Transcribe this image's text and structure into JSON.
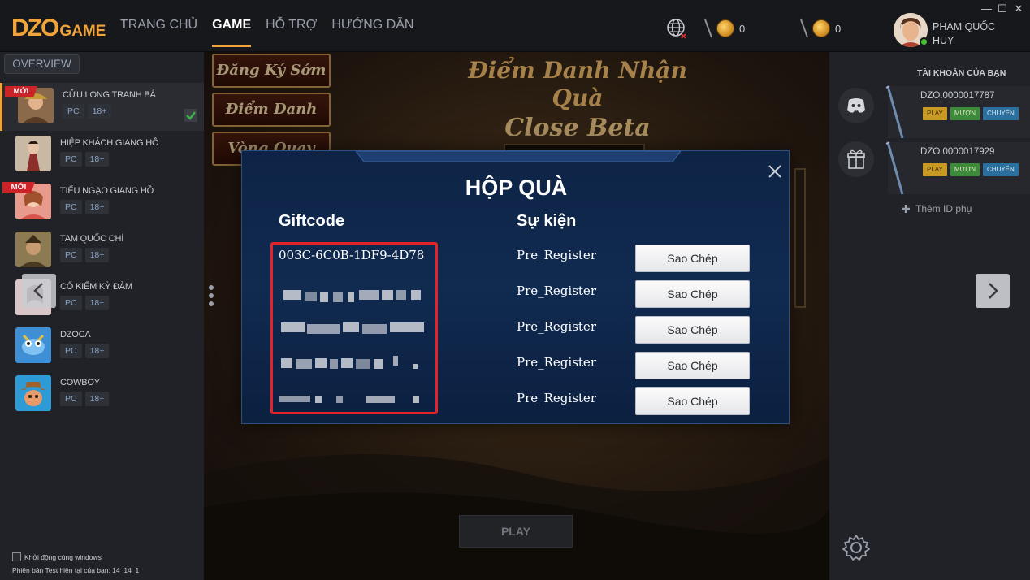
{
  "topbar": {
    "logo_main": "DZO",
    "logo_sub": "GAME",
    "nav": [
      {
        "label": "TRANG CHỦ",
        "active": false
      },
      {
        "label": "GAME",
        "active": true
      },
      {
        "label": "HỖ TRỢ",
        "active": false
      },
      {
        "label": "HƯỚNG DẪN",
        "active": false
      }
    ],
    "coin1": "0",
    "coin2": "0",
    "user_name": "PHẠM QUỐC HUY",
    "brand_color": "#f0a43a"
  },
  "sidebar": {
    "overview_label": "OVERVIEW",
    "new_badge": "MỚI",
    "games": [
      {
        "name": "CỬU LONG TRANH BÁ",
        "tag1": "PC",
        "tag2": "18+",
        "new": true,
        "selected": true
      },
      {
        "name": "HIỆP KHÁCH GIANG HỒ",
        "tag1": "PC",
        "tag2": "18+",
        "new": false,
        "selected": false
      },
      {
        "name": "TIẾU NGẠO GIANG HỒ",
        "tag1": "PC",
        "tag2": "18+",
        "new": true,
        "selected": false
      },
      {
        "name": "TAM QUỐC CHÍ",
        "tag1": "PC",
        "tag2": "18+",
        "new": false,
        "selected": false
      },
      {
        "name": "CỔ KIẾM KỲ ĐÀM",
        "tag1": "PC",
        "tag2": "18+",
        "new": false,
        "selected": false
      },
      {
        "name": "DZOCA",
        "tag1": "PC",
        "tag2": "18+",
        "new": false,
        "selected": false
      },
      {
        "name": "COWBOY",
        "tag1": "PC",
        "tag2": "18+",
        "new": false,
        "selected": false
      }
    ],
    "startup_label": "Khởi động cùng windows",
    "version_label": "Phiên bản Test hiện tại của bạn: 14_14_1"
  },
  "main": {
    "menu": [
      "Đăng Ký Sớm",
      "Điểm Danh",
      "Vòng Quay"
    ],
    "event_title_1": "Điểm Danh Nhận Quà",
    "event_title_2": "Close Beta",
    "play_label": "PLAY"
  },
  "rightpanel": {
    "title": "TÀI KHOẢN CỦA BẠN",
    "accounts": [
      {
        "id": "DZO.0000017787",
        "play": "PLAY",
        "borrow": "MƯỢN",
        "transfer": "CHUYỂN"
      },
      {
        "id": "DZO.0000017929",
        "play": "PLAY",
        "borrow": "MƯỢN",
        "transfer": "CHUYỂN"
      }
    ],
    "add_sub_label": "Thêm ID phụ"
  },
  "modal": {
    "title": "HỘP QUÀ",
    "col_giftcode": "Giftcode",
    "col_event": "Sự kiện",
    "first_code": "003C-6C0B-1DF9-4D78",
    "rows": [
      {
        "event": "Pre_Register",
        "copy": "Sao Chép"
      },
      {
        "event": "Pre_Register",
        "copy": "Sao Chép"
      },
      {
        "event": "Pre_Register",
        "copy": "Sao Chép"
      },
      {
        "event": "Pre_Register",
        "copy": "Sao Chép"
      },
      {
        "event": "Pre_Register",
        "copy": "Sao Chép"
      }
    ],
    "highlight_color": "#e42229"
  }
}
